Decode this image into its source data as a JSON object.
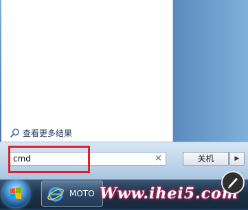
{
  "start_menu": {
    "see_more_results": "查看更多结果",
    "search": {
      "value": "cmd",
      "clear_symbol": "×"
    },
    "shutdown_label": "关机",
    "shutdown_arrow": "▶"
  },
  "taskbar": {
    "task_label": "MOTO"
  },
  "watermark": {
    "text": "Www.ihei5.com"
  },
  "colors": {
    "highlight": "#e2202a"
  }
}
